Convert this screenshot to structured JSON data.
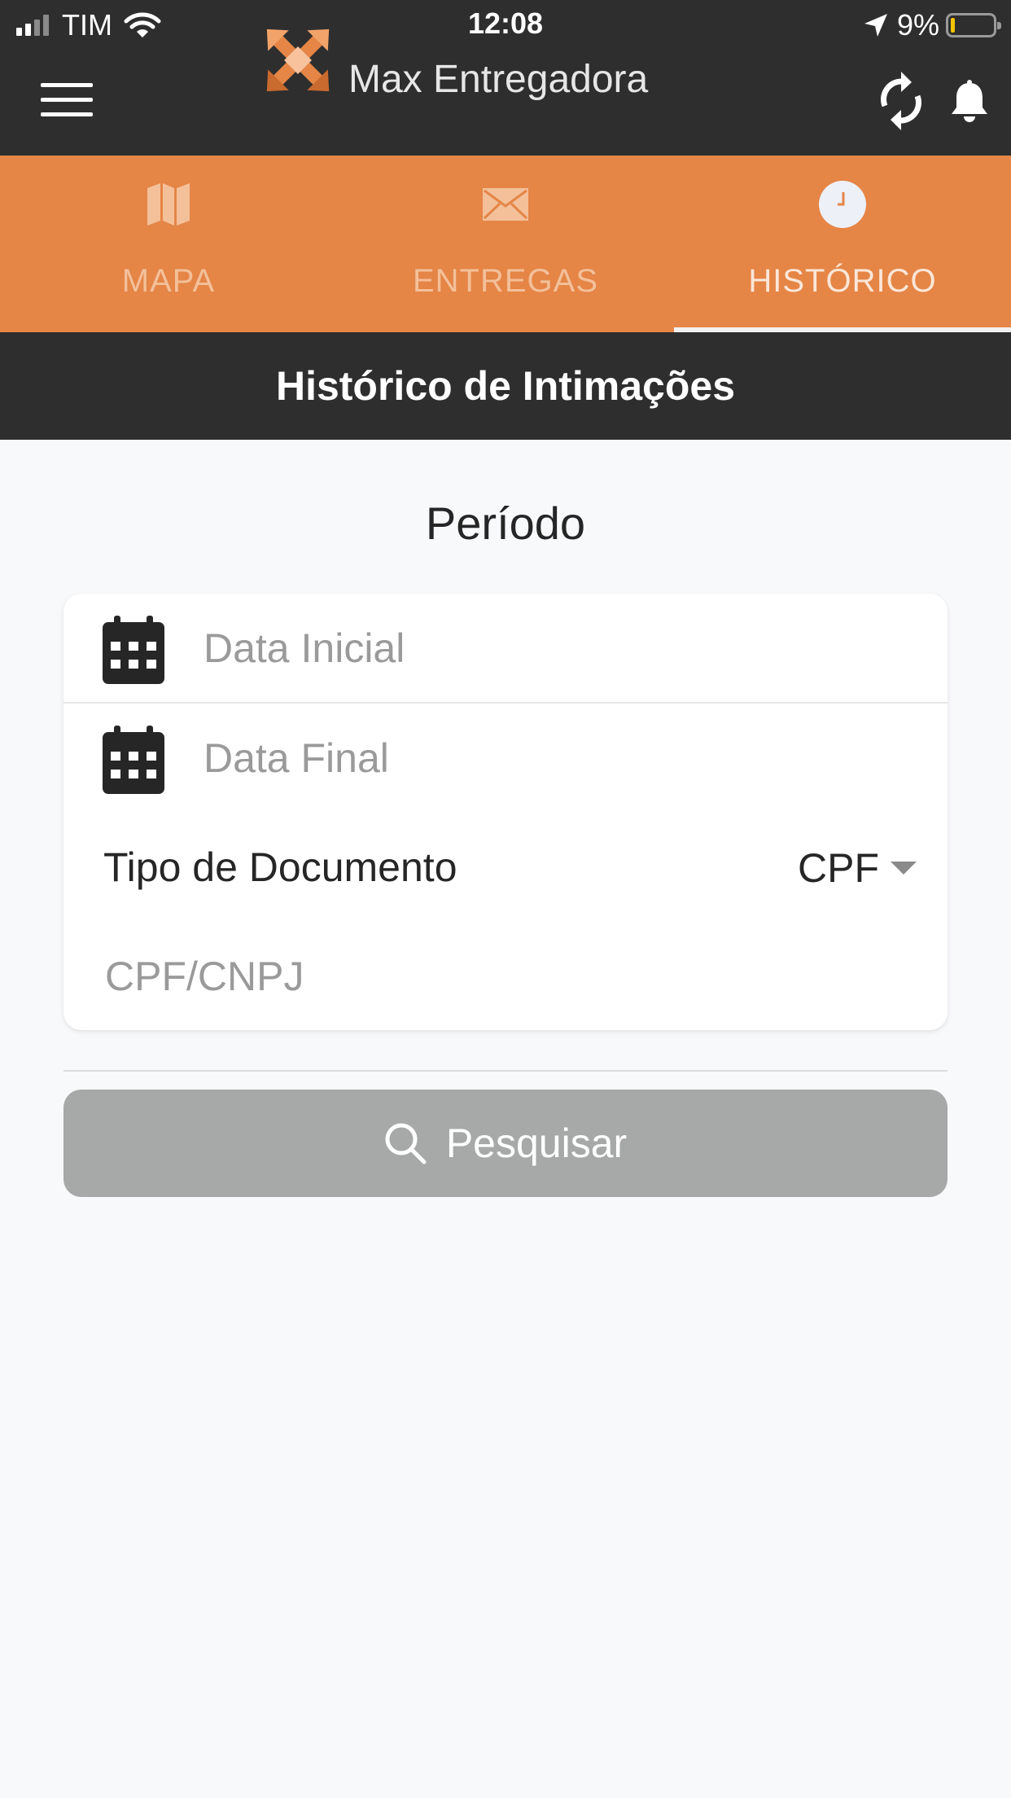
{
  "status_bar": {
    "carrier": "TIM",
    "time": "12:08",
    "battery_percent": "9%",
    "battery_level": 0.09,
    "signal_bars_active": 2,
    "signal_bars_total": 4,
    "icons": [
      "signal-icon",
      "wifi-icon",
      "location-arrow-icon",
      "battery-icon"
    ]
  },
  "app_bar": {
    "title": "Max Entregadora",
    "icons": [
      "menu-icon",
      "logo-icon",
      "sync-icon",
      "bell-icon"
    ]
  },
  "tabs": [
    {
      "label": "MAPA",
      "icon": "map-icon",
      "active": false
    },
    {
      "label": "ENTREGAS",
      "icon": "envelope-icon",
      "active": false
    },
    {
      "label": "HISTÓRICO",
      "icon": "clock-icon",
      "active": true
    }
  ],
  "section": {
    "title": "Histórico de Intimações"
  },
  "form": {
    "period_title": "Período",
    "data_inicial": {
      "value": "",
      "placeholder": "Data Inicial",
      "icon": "calendar-icon"
    },
    "data_final": {
      "value": "",
      "placeholder": "Data Final",
      "icon": "calendar-icon"
    },
    "tipo_documento": {
      "label": "Tipo de Documento",
      "selected": "CPF"
    },
    "documento": {
      "value": "",
      "placeholder": "CPF/CNPJ"
    },
    "search_button": {
      "label": "Pesquisar",
      "icon": "search-icon"
    }
  },
  "colors": {
    "header_bg": "#2e2e2e",
    "tab_bar_bg": "#e58546",
    "tab_label": "#f3c09a",
    "tab_indicator": "#f1f1f1",
    "page_bg": "#f8f9fb",
    "button_disabled_bg": "#a7a8a8",
    "battery_low": "#f5c400"
  }
}
